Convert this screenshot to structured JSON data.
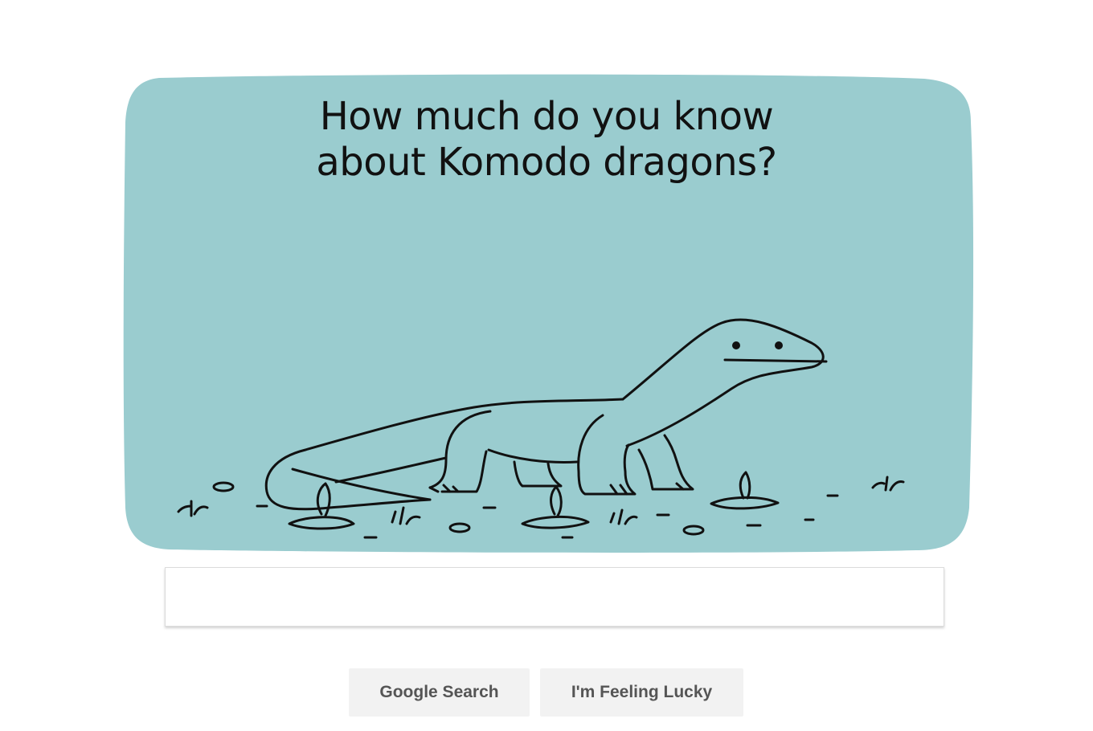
{
  "doodle": {
    "title": "How much do you know about Komodo dragons?",
    "background_color": "#9acccf",
    "line_color": "#111111",
    "illustration": "komodo-dragon"
  },
  "search": {
    "value": "",
    "placeholder": ""
  },
  "buttons": {
    "google_search": "Google Search",
    "feeling_lucky": "I'm Feeling Lucky"
  }
}
